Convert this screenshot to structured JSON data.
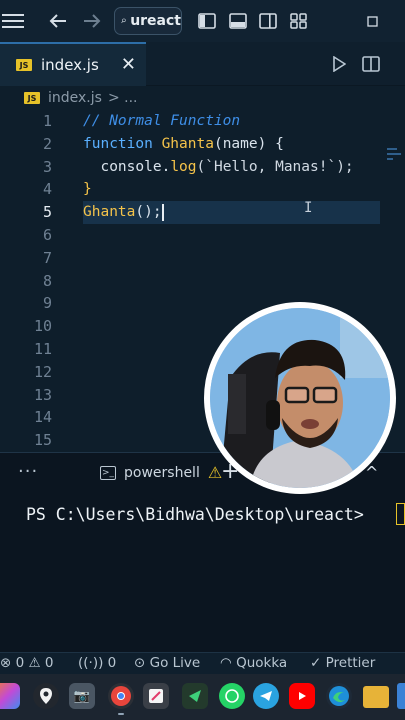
{
  "titlebar": {
    "search_text": "ureact",
    "icons": [
      "menu-icon",
      "back-arrow-icon",
      "forward-arrow-icon",
      "search-icon",
      "toggle-sidebar-icon",
      "toggle-panel-icon",
      "toggle-secondary-sidebar-icon",
      "customize-layout-icon",
      "maximize-icon"
    ]
  },
  "tab": {
    "label": "index.js",
    "badge": "JS"
  },
  "breadcrumb": {
    "file": "index.js",
    "separator": "> ...",
    "badge": "JS"
  },
  "editor": {
    "line_numbers": [
      "1",
      "2",
      "3",
      "4",
      "5",
      "6",
      "7",
      "8",
      "9",
      "10",
      "11",
      "12",
      "13",
      "14",
      "15"
    ],
    "active_line": "5",
    "code": {
      "line1_comment": "// Normal Function",
      "line2_keyword": "function",
      "line2_name": "Ghanta",
      "line2_params": "(name) {",
      "line3_indent": "  ",
      "line3_object": "console",
      "line3_dot": ".",
      "line3_method": "log",
      "line3_rest": "(`Hello, Manas!`);",
      "line4_brace": "}",
      "line5_call": "Ghanta",
      "line5_rest": "();"
    }
  },
  "terminal": {
    "more": "···",
    "tab_label": "powershell",
    "plus": "+",
    "chevron": "^",
    "prompt": "PS C:\\Users\\Bidhwa\\Desktop\\ureact>"
  },
  "statusbar": {
    "problems": "⊗ 0 ⚠ 0",
    "ports": "0",
    "go_live": "Go Live",
    "quokka": "Quokka",
    "prettier": "Prettier"
  },
  "colors": {
    "background": "#0e1e2b",
    "accent": "#2d6ea8",
    "js_badge": "#e6c229",
    "keyword": "#5ab0ff",
    "function": "#f4c34a"
  }
}
